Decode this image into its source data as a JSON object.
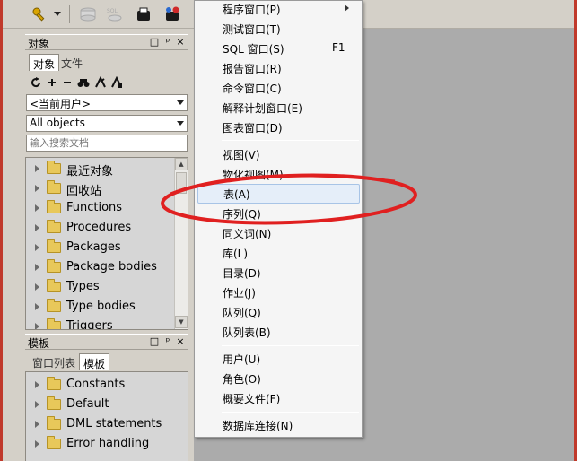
{
  "object_panel": {
    "title": "对象",
    "tabs": [
      "对象",
      "文件"
    ],
    "user_filter": "<当前用户>",
    "type_filter": "All objects",
    "search_placeholder": "输入搜索文档",
    "tree_items": [
      "最近对象",
      "回收站",
      "Functions",
      "Procedures",
      "Packages",
      "Package bodies",
      "Types",
      "Type bodies",
      "Triggers"
    ]
  },
  "template_panel": {
    "title": "模板",
    "tabs": [
      "窗口列表",
      "模板"
    ],
    "tree_items": [
      "Constants",
      "Default",
      "DML statements",
      "Error handling"
    ]
  },
  "panel_controls": {
    "restore": "□",
    "pin": "ᵖ",
    "close": "×"
  },
  "menu": {
    "group1": [
      {
        "label": "程序窗口(P)",
        "submenu": true
      },
      {
        "label": "测试窗口(T)"
      },
      {
        "label": "SQL 窗口(S)",
        "shortcut": "F1"
      },
      {
        "label": "报告窗口(R)"
      },
      {
        "label": "命令窗口(C)"
      },
      {
        "label": "解释计划窗口(E)"
      },
      {
        "label": "图表窗口(D)"
      }
    ],
    "group2": [
      {
        "label": "视图(V)"
      },
      {
        "label": "物化视图(M)"
      },
      {
        "label": "表(A)",
        "highlighted": true
      },
      {
        "label": "序列(Q)"
      },
      {
        "label": "同义词(N)"
      },
      {
        "label": "库(L)"
      },
      {
        "label": "目录(D)"
      },
      {
        "label": "作业(J)"
      },
      {
        "label": "队列(Q)"
      },
      {
        "label": "队列表(B)"
      }
    ],
    "group3": [
      {
        "label": "用户(U)"
      },
      {
        "label": "角色(O)"
      },
      {
        "label": "概要文件(F)"
      }
    ],
    "group4": [
      {
        "label": "数据库连接(N)"
      }
    ]
  },
  "colors": {
    "annotation_ellipse": "#e02020",
    "folder": "#e8c85a",
    "menu_highlight": "#e5eef9"
  },
  "icons": [
    "key-icon",
    "dropdown-arrow-icon",
    "database-icon",
    "sql-icon",
    "new-object-icon",
    "connect-icon",
    "refresh-icon",
    "add-icon",
    "remove-icon",
    "find-icon",
    "filter-icon",
    "filter-alt-icon",
    "folder-icon",
    "expand-arrow-icon",
    "submenu-arrow-icon"
  ]
}
